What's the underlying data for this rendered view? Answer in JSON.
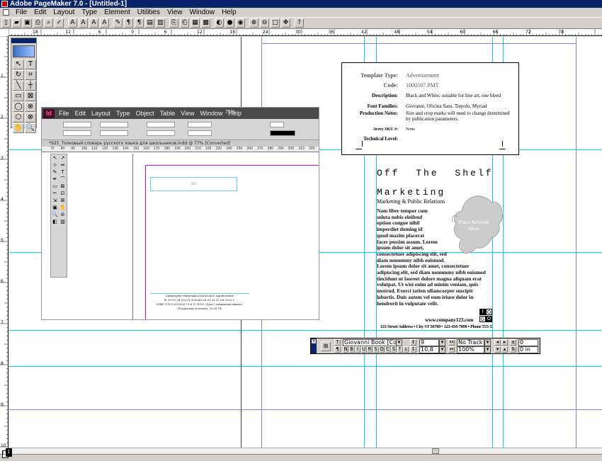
{
  "app": {
    "title": "Adobe PageMaker 7.0 - [Untitled-1]"
  },
  "menu": [
    "File",
    "Edit",
    "Layout",
    "Type",
    "Element",
    "Utilities",
    "View",
    "Window",
    "Help"
  ],
  "toolbar_icons": [
    "new-doc-icon",
    "open-icon",
    "save-icon",
    "print-icon",
    "find-icon",
    "spell-icon",
    "type-A-icon",
    "font-size-A-icon",
    "superscript-A-icon",
    "indent-A-icon",
    "edit-story-icon",
    "pilcrow-icon",
    "paragraph-icon",
    "text-box-icon",
    "pages-icon",
    "copy-icon",
    "paste-icon",
    "grid-icon",
    "image-icon",
    "color-icon",
    "globe-icon",
    "eye-icon",
    "zoom-in-icon",
    "zoom-out-icon",
    "zoom-100-icon",
    "pan-icon",
    "help-icon"
  ],
  "hruler_labels": [
    "18",
    "12",
    "6",
    "0",
    "6",
    "12",
    "18",
    "24",
    "30",
    "36",
    "42",
    "48",
    "54",
    "60",
    "66",
    "72",
    "78"
  ],
  "vruler_labels": [
    "1",
    "2",
    "3",
    "4",
    "5",
    "6",
    "7",
    "8",
    "9",
    "10"
  ],
  "toolbox": {
    "tools": [
      "pointer-icon",
      "text-tool-icon",
      "rotate-icon",
      "crop-icon",
      "line-icon",
      "constrained-line-icon",
      "rectangle-icon",
      "rect-frame-icon",
      "ellipse-icon",
      "ellipse-frame-icon",
      "polygon-icon",
      "polygon-frame-icon",
      "hand-icon",
      "zoom-tool-icon"
    ],
    "glyphs": [
      "↖",
      "T",
      "↻",
      "⌗",
      "╲",
      "┼",
      "▭",
      "⊠",
      "◯",
      "⊗",
      "⬡",
      "⊗",
      "✋",
      "🔍"
    ]
  },
  "indesign": {
    "logo": "Id",
    "menu": [
      "File",
      "Edit",
      "Layout",
      "Type",
      "Object",
      "Table",
      "View",
      "Window",
      "Help"
    ],
    "zoom": "75%",
    "doc_tab": "*925_Толковый словарь русского языка для школьников.indd @ 77% [Converted]",
    "ruler": [
      "70",
      "80",
      "90",
      "100",
      "110",
      "120",
      "130",
      "140",
      "150",
      "160",
      "170",
      "180",
      "190",
      "200",
      "210",
      "220",
      "230",
      "240",
      "250",
      "260",
      "270",
      "280",
      "290",
      "300",
      "310",
      "320"
    ],
    "frame_text": "280",
    "footer_lines": [
      "Санитарно-эпидемиологическое заключение",
      "№ 29.01.04.953.П.003288.08.09 от 27.08.2009 г.",
      "ISBN 978-5-903036-75-8          © ООО «Дом Славянской книги»",
      "Подписано в печать 15.08.14"
    ]
  },
  "template": {
    "rows": [
      {
        "k": "Template Type:",
        "v": "Advertisement",
        "big": true
      },
      {
        "k": "Code:",
        "v": "1000597.PMT",
        "big": true
      },
      {
        "k": "Description:",
        "v": "Black and White, suitable for line art, one bleed"
      },
      {
        "k": "Font Families:",
        "v": "Giovanni, Oficina Sans, Tiepolo, Myriad"
      },
      {
        "k": "Production Notes:",
        "v": "Size and crop marks will need to change determined by publication parameters."
      },
      {
        "k": "Avery SKU #:",
        "v": "None"
      },
      {
        "k": "Technical Level:",
        "v": ""
      }
    ]
  },
  "ad": {
    "headline1": "Off  The  Shelf",
    "headline2": "Marketing",
    "subhead": "Marketing & Public Relations",
    "body_short": [
      "Nam liber tempor cum",
      "soluta nobis eleifend",
      "option congue nihil",
      "imperdiet doming id",
      "quod mazim placerat",
      "facer possim assum. Lorem",
      "ipsum dolor sit amet,",
      "consectetuer adipiscing elit, sed",
      "diam nonummy nibh euismod."
    ],
    "body_long": "Lorem ipsum dolor sit amet, consectetuer adipiscing elit, sed diam nonummy nibh euismod tincidunt ut laoreet dolore magna aliquam erat volutpat. Ut wisi enim ad minim veniam, quis nostrud. Exerci tation ullamcorper suscipit lobortis. Duis autem vel eum iriure dolor in hendrerit in vulputate velit.",
    "art_placeholder": "Place Artwork Here",
    "logo_letters": [
      "I",
      "O",
      "G",
      "O"
    ],
    "contact": "www.company123.com",
    "address": "123 Street Address • City ST 56789 • 123-456-7890 • Phone 555-555-5555 • Fax 555-555-5555"
  },
  "control_palette": {
    "font": "Giovanni Book [Cou",
    "size": "9",
    "leading": "10,8",
    "track": "No Track",
    "width": "100%",
    "kern": "0",
    "baseline": "0 in",
    "style_buttons": [
      "N",
      "B",
      "I",
      "U",
      "R",
      "S",
      "O",
      "C",
      "S",
      "↑",
      "↓"
    ]
  },
  "colors": {
    "guide_cyan": "#00d0e0",
    "guide_blue": "#8080ff",
    "title_blue": "#0a246a",
    "chrome": "#d4d0c8"
  }
}
